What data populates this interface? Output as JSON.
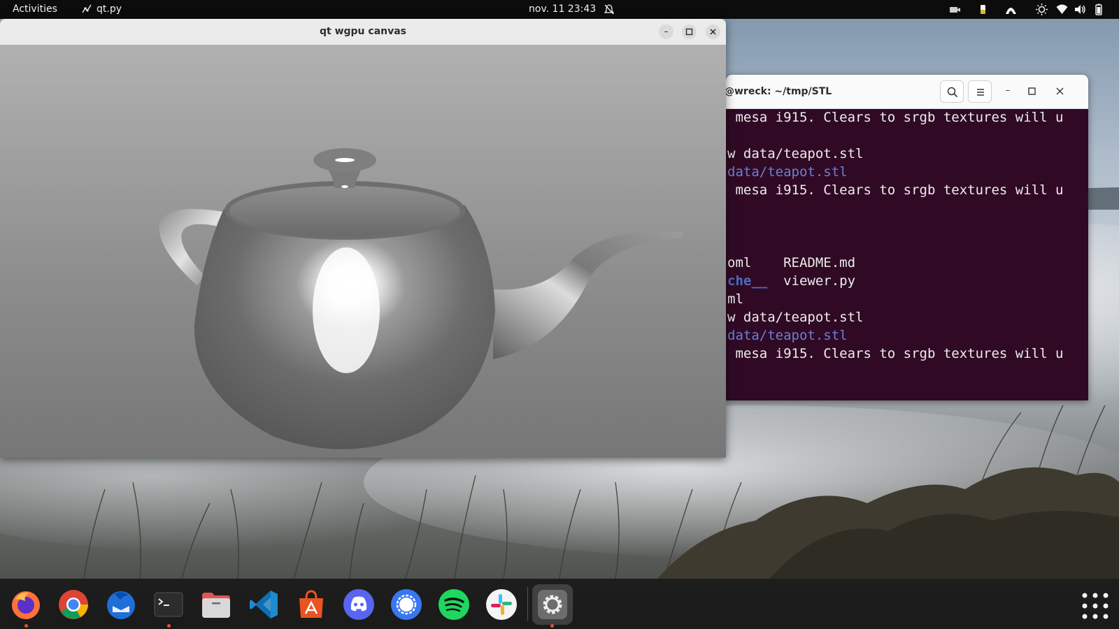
{
  "topbar": {
    "activities": "Activities",
    "app_name": "qt.py",
    "clock": "nov. 11  23:43",
    "tray_icons": [
      "camera-icon",
      "battery-low-icon",
      "accessibility-icon",
      "brightness-icon",
      "wifi-icon",
      "volume-icon",
      "battery-icon"
    ]
  },
  "qt_window": {
    "title": "qt wgpu canvas",
    "controls": [
      "minimize",
      "maximize",
      "close"
    ]
  },
  "terminal": {
    "title": "@wreck: ~/tmp/STL",
    "lines": [
      " mesa i915. Clears to srgb textures will u",
      "",
      "w data/teapot.stl",
      "data/teapot.stl",
      " mesa i915. Clears to srgb textures will u",
      "",
      "",
      "",
      "oml    README.md",
      "che__  viewer.py",
      "ml",
      "w data/teapot.stl",
      "data/teapot.stl",
      " mesa i915. Clears to srgb textures will u"
    ],
    "che_dir": "che__",
    "viewer": "  viewer.py"
  },
  "dock": {
    "apps": [
      "Firefox",
      "Chrome",
      "Thunderbird",
      "Terminal",
      "Files",
      "VS Code",
      "App Center",
      "Discord",
      "Signal",
      "Spotify",
      "Slack",
      "Settings"
    ],
    "show_apps": "show-applications"
  },
  "colors": {
    "terminal_bg": "#300a24",
    "topbar_bg": "#0c0c0c",
    "ubuntu_orange": "#e95420"
  }
}
